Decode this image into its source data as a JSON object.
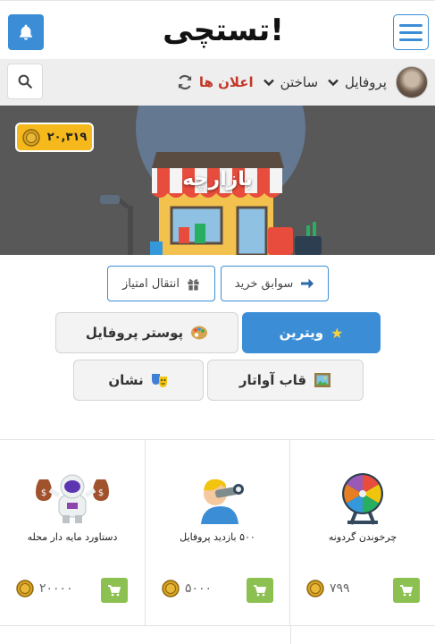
{
  "header": {
    "logo_text": "تستچی!",
    "brand_color": "#3b8ed6"
  },
  "nav": {
    "profile_label": "پروفایل",
    "build_label": "ساختن",
    "notifications_label": "اعلان ها"
  },
  "hero": {
    "coins": "۲۰,۳۱۹",
    "title": "بازارچه"
  },
  "actions": {
    "history_label": "سوابق خرید",
    "transfer_label": "انتقال امتیاز"
  },
  "tabs": {
    "showcase_label": "ویترین",
    "poster_label": "پوستر پروفایل",
    "frame_label": "قاب آواتار",
    "badge_label": "نشان"
  },
  "products": [
    {
      "name": "چرخوندن گردونه",
      "price": "۷۹۹",
      "icon": "fortune-wheel-icon"
    },
    {
      "name": "۵۰۰ بازدید پروفایل",
      "price": "۵۰۰۰",
      "icon": "telescope-boy-icon"
    },
    {
      "name": "دستاورد مایه دار محله",
      "price": "۲۰۰۰۰",
      "icon": "astronaut-moneybags-icon"
    }
  ],
  "colors": {
    "accent": "#3b8ed6",
    "coin": "#f6b91c",
    "cart": "#8cc152",
    "alert": "#c0392b"
  }
}
